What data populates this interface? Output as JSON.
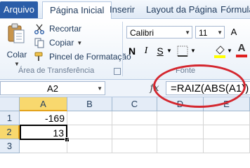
{
  "tabs": {
    "file": "Arquivo",
    "items": [
      "Página Inicial",
      "Inserir",
      "Layout da Página",
      "Fórmulas"
    ]
  },
  "clipboard": {
    "paste": "Colar",
    "cut": "Recortar",
    "copy": "Copiar",
    "format_painter": "Pincel de Formatação",
    "group_label": "Área de Transferência"
  },
  "font": {
    "name": "Calibri",
    "size": "11",
    "group_label": "Fonte",
    "bold": "N",
    "italic": "I",
    "underline": "S"
  },
  "formula_bar": {
    "name_box": "A2",
    "fx": "fx",
    "formula": "=RAIZ(ABS(A1))"
  },
  "grid": {
    "columns": [
      "A",
      "B",
      "C",
      "D",
      "E"
    ],
    "rows": [
      "1",
      "2",
      "3"
    ],
    "cells": {
      "A1": "-169",
      "A2": "13"
    }
  },
  "colors": {
    "file_tab": "#2a5da8",
    "highlight": "#d4262e",
    "selected_header": "#f8d86e"
  }
}
